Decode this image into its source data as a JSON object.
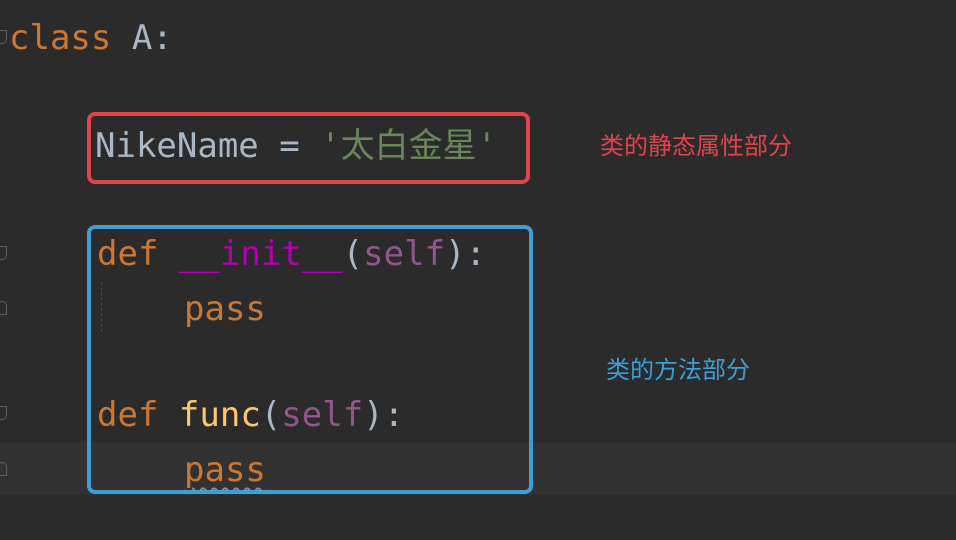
{
  "code": {
    "line1": {
      "keyword": "class",
      "rest": " A:"
    },
    "line2": {
      "name": "NikeName",
      "op": " = ",
      "value": "'太白金星'"
    },
    "line3": {
      "keyword": "def",
      "space": " ",
      "func": "__init__",
      "open": "(",
      "param": "self",
      "close": "):"
    },
    "line4": {
      "keyword": "pass"
    },
    "line5": {
      "keyword": "def",
      "space": " ",
      "func": "func",
      "open": "(",
      "param": "self",
      "close": "):"
    },
    "line6": {
      "keyword": "pass"
    }
  },
  "annotations": {
    "static_attr": "类的静态属性部分",
    "methods": "类的方法部分"
  },
  "colors": {
    "background": "#2b2b2b",
    "keyword": "#cc7832",
    "string": "#6a8759",
    "dunder": "#b200b2",
    "self": "#94558d",
    "function": "#ffc66d",
    "text": "#a9b7c6",
    "red_box": "#e2444b",
    "blue_box": "#3d9fd6"
  }
}
